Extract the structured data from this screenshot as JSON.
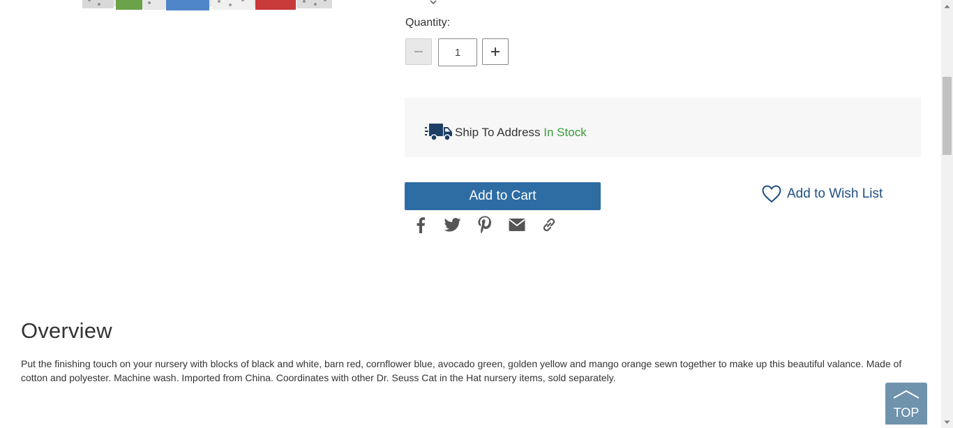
{
  "product": {
    "quantity_label": "Quantity:",
    "quantity_value": "1"
  },
  "shipping": {
    "method": "Ship To Address",
    "status": "In Stock",
    "status_color": "#3a9a3a"
  },
  "actions": {
    "add_to_cart": "Add to Cart",
    "add_to_wishlist": "Add to Wish List"
  },
  "share": {
    "icons": [
      "facebook-icon",
      "twitter-icon",
      "pinterest-icon",
      "email-icon",
      "link-icon"
    ]
  },
  "overview": {
    "title": "Overview",
    "description": "Put the finishing touch on your nursery with blocks of black and white, barn red, cornflower blue, avocado green, golden yellow and mango orange sewn together to make up this beautiful valance. Made of cotton and polyester. Machine wash. Imported from China. Coordinates with other Dr. Seuss Cat in the Hat nursery items, sold separately."
  },
  "back_to_top": {
    "label": "TOP"
  },
  "colors": {
    "primary_button": "#2e6ca4",
    "link_blue": "#1f4f80",
    "top_button": "#6f93ad"
  }
}
